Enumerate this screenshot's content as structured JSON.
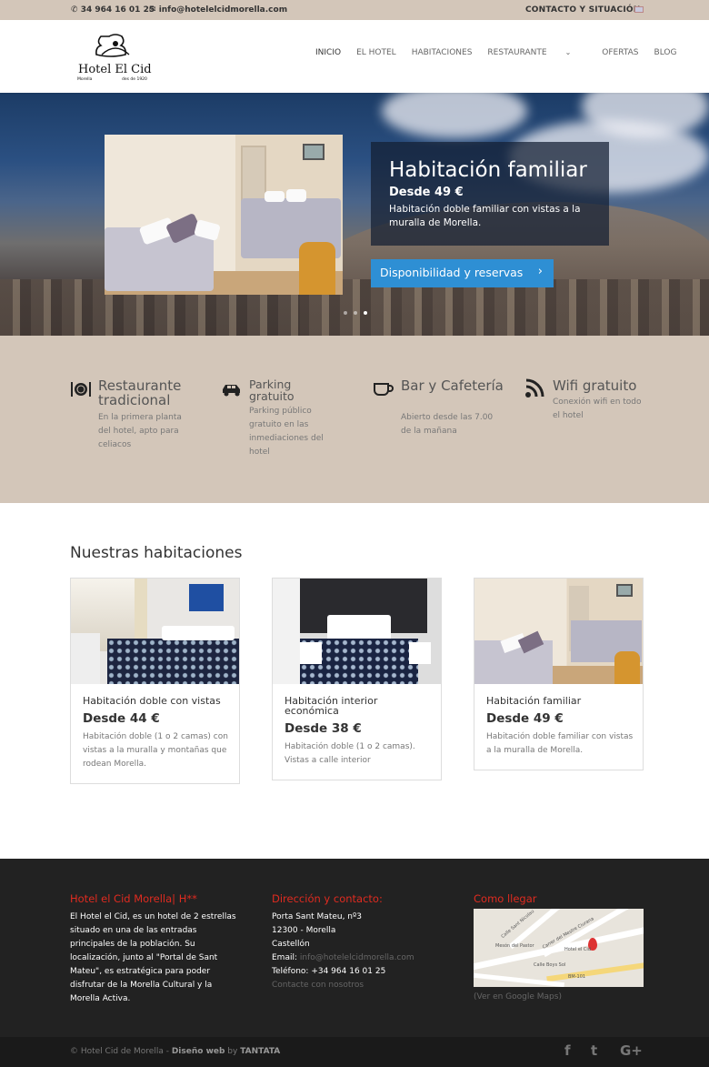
{
  "topbar": {
    "phone": "34 964 16 01 25",
    "email": "info@hotelelcidmorella.com",
    "contact": "CONTACTO Y SITUACIÓN",
    "flag_icon": "uk-flag-icon"
  },
  "logo": {
    "name": "Hotel El Cid",
    "tag_left": "Morella",
    "tag_right": "des de 1920"
  },
  "nav": {
    "items": [
      "INICIO",
      "EL HOTEL",
      "HABITACIONES",
      "RESTAURANTE",
      "OFERTAS",
      "BLOG"
    ],
    "active": "INICIO"
  },
  "hero": {
    "title": "Habitación familiar",
    "price": "Desde 49 €",
    "description": "Habitación doble familiar con vistas a la muralla de Morella.",
    "button": "Disponibilidad y reservas",
    "slides_count": 3,
    "active_slide": 3
  },
  "features": [
    {
      "icon": "cutlery-icon",
      "title": "Restaurante tradicional",
      "text": "En la primera planta del hotel, apto para celiacos"
    },
    {
      "icon": "car-icon",
      "title": "Parking gratuito",
      "text": "Parking público gratuito en las inmediaciones del hotel"
    },
    {
      "icon": "coffee-cup-icon",
      "title": "Bar y Cafetería",
      "text": "Abierto desde las 7.00 de la mañana"
    },
    {
      "icon": "wifi-icon",
      "title": "Wifi gratuito",
      "text": "Conexión wifi en todo el hotel"
    }
  ],
  "rooms": {
    "title": "Nuestras habitaciones",
    "items": [
      {
        "name": "Habitación doble con vistas",
        "price": "Desde 44 €",
        "description": "Habitación doble (1 o 2 camas) con vistas a la muralla y montañas que rodean Morella."
      },
      {
        "name": "Habitación interior económica",
        "price": "Desde 38 €",
        "description": "Habitación doble (1 o 2 camas). Vistas a calle interior"
      },
      {
        "name": "Habitación familiar",
        "price": "Desde 49 €",
        "description": "Habitación doble familiar con vistas a la muralla de Morella."
      }
    ]
  },
  "footer": {
    "about": {
      "title": "Hotel el Cid Morella| H**",
      "text": "El Hotel el Cid, es un hotel de 2 estrellas situado en una de las entradas principales de la población. Su localización, junto al \"Portal de Sant Mateu\", es estratégica para poder disfrutar de la Morella Cultural y la Morella Activa."
    },
    "contact": {
      "title": "Dirección y contacto:",
      "address1": "Porta Sant Mateu, nº3",
      "address2": "12300 - Morella",
      "address3": "Castellón",
      "email_label": "Email:",
      "email": "info@hotelelcidmorella.com",
      "phone": "Teléfono: +34 964 16 01 25",
      "link": "Contacte con nosotros"
    },
    "map": {
      "title": "Como llegar",
      "caption": "(Ver en Google Maps)",
      "labels": [
        "Calle Sant Nicolau",
        "Carrer del Mestre Ciurana",
        "Mesón del Pastor",
        "Hotel el Cid",
        "Calle Boys Sol",
        "BM-101"
      ]
    }
  },
  "bottom": {
    "copyright": "© Hotel Cid de Morella - ",
    "design": "Diseño web",
    "by": " by ",
    "agency": "TANTATA",
    "social": [
      "facebook-icon",
      "twitter-icon",
      "google-plus-icon"
    ],
    "social_glyphs": [
      "f",
      "t",
      "G+"
    ]
  },
  "colors": {
    "topbar": "#d3c6b9",
    "accent_blue": "#2e8fd4",
    "footer_heading": "#e02b20",
    "footer_bg": "#222222"
  }
}
